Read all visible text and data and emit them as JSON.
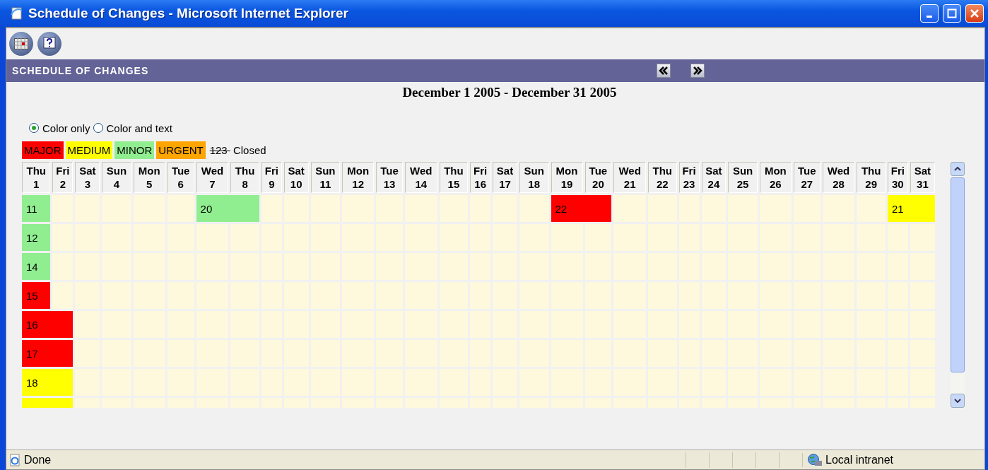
{
  "window": {
    "title": "Schedule of Changes - Microsoft Internet Explorer"
  },
  "header": {
    "title": "SCHEDULE OF CHANGES"
  },
  "date_range": "December 1 2005 - December 31 2005",
  "view_options": [
    {
      "label": "Color only",
      "selected": true
    },
    {
      "label": "Color and text",
      "selected": false
    }
  ],
  "legend": [
    {
      "kind": "swatch",
      "label": "MAJOR",
      "color": "#ff0000"
    },
    {
      "kind": "swatch",
      "label": "MEDIUM",
      "color": "#ffff00"
    },
    {
      "kind": "swatch",
      "label": "MINOR",
      "color": "#90ee90"
    },
    {
      "kind": "swatch",
      "label": "URGENT",
      "color": "#ffa500"
    },
    {
      "kind": "closed",
      "sample": "123",
      "label": "Closed"
    }
  ],
  "days": [
    {
      "weekday": "Thu",
      "day": "1"
    },
    {
      "weekday": "Fri",
      "day": "2"
    },
    {
      "weekday": "Sat",
      "day": "3"
    },
    {
      "weekday": "Sun",
      "day": "4"
    },
    {
      "weekday": "Mon",
      "day": "5"
    },
    {
      "weekday": "Tue",
      "day": "6"
    },
    {
      "weekday": "Wed",
      "day": "7"
    },
    {
      "weekday": "Thu",
      "day": "8"
    },
    {
      "weekday": "Fri",
      "day": "9"
    },
    {
      "weekday": "Sat",
      "day": "10"
    },
    {
      "weekday": "Sun",
      "day": "11"
    },
    {
      "weekday": "Mon",
      "day": "12"
    },
    {
      "weekday": "Tue",
      "day": "13"
    },
    {
      "weekday": "Wed",
      "day": "14"
    },
    {
      "weekday": "Thu",
      "day": "15"
    },
    {
      "weekday": "Fri",
      "day": "16"
    },
    {
      "weekday": "Sat",
      "day": "17"
    },
    {
      "weekday": "Sun",
      "day": "18"
    },
    {
      "weekday": "Mon",
      "day": "19"
    },
    {
      "weekday": "Tue",
      "day": "20"
    },
    {
      "weekday": "Wed",
      "day": "21"
    },
    {
      "weekday": "Thu",
      "day": "22"
    },
    {
      "weekday": "Fri",
      "day": "23"
    },
    {
      "weekday": "Sat",
      "day": "24"
    },
    {
      "weekday": "Sun",
      "day": "25"
    },
    {
      "weekday": "Mon",
      "day": "26"
    },
    {
      "weekday": "Tue",
      "day": "27"
    },
    {
      "weekday": "Wed",
      "day": "28"
    },
    {
      "weekday": "Thu",
      "day": "29"
    },
    {
      "weekday": "Fri",
      "day": "30"
    },
    {
      "weekday": "Sat",
      "day": "31"
    }
  ],
  "rows": [
    {
      "cells": [
        {
          "kind": "change",
          "label": "11",
          "color": "#90ee90"
        },
        {
          "kind": "empty"
        },
        {
          "kind": "empty"
        },
        {
          "kind": "empty"
        },
        {
          "kind": "empty"
        },
        {
          "kind": "empty"
        },
        {
          "kind": "change",
          "label": "20",
          "color": "#90ee90"
        },
        {
          "kind": "continued"
        },
        {
          "kind": "empty"
        },
        {
          "kind": "empty"
        },
        {
          "kind": "empty"
        },
        {
          "kind": "empty"
        },
        {
          "kind": "empty"
        },
        {
          "kind": "empty"
        },
        {
          "kind": "empty"
        },
        {
          "kind": "empty"
        },
        {
          "kind": "empty"
        },
        {
          "kind": "empty"
        },
        {
          "kind": "change",
          "label": "22",
          "color": "#ff0000"
        },
        {
          "kind": "continued"
        },
        {
          "kind": "empty"
        },
        {
          "kind": "empty"
        },
        {
          "kind": "empty"
        },
        {
          "kind": "empty"
        },
        {
          "kind": "empty"
        },
        {
          "kind": "empty"
        },
        {
          "kind": "empty"
        },
        {
          "kind": "empty"
        },
        {
          "kind": "empty"
        },
        {
          "kind": "change",
          "label": "21",
          "color": "#ffff00"
        },
        {
          "kind": "continued"
        }
      ]
    },
    {
      "cells": [
        {
          "kind": "change",
          "label": "12",
          "color": "#90ee90"
        },
        {
          "kind": "empty"
        },
        {
          "kind": "empty"
        },
        {
          "kind": "empty"
        },
        {
          "kind": "empty"
        },
        {
          "kind": "empty"
        },
        {
          "kind": "empty"
        },
        {
          "kind": "empty"
        },
        {
          "kind": "empty"
        },
        {
          "kind": "empty"
        },
        {
          "kind": "empty"
        },
        {
          "kind": "empty"
        },
        {
          "kind": "empty"
        },
        {
          "kind": "empty"
        },
        {
          "kind": "empty"
        },
        {
          "kind": "empty"
        },
        {
          "kind": "empty"
        },
        {
          "kind": "empty"
        },
        {
          "kind": "empty"
        },
        {
          "kind": "empty"
        },
        {
          "kind": "empty"
        },
        {
          "kind": "empty"
        },
        {
          "kind": "empty"
        },
        {
          "kind": "empty"
        },
        {
          "kind": "empty"
        },
        {
          "kind": "empty"
        },
        {
          "kind": "empty"
        },
        {
          "kind": "empty"
        },
        {
          "kind": "empty"
        },
        {
          "kind": "empty"
        },
        {
          "kind": "empty"
        }
      ]
    },
    {
      "cells": [
        {
          "kind": "change",
          "label": "14",
          "color": "#90ee90"
        },
        {
          "kind": "empty"
        },
        {
          "kind": "empty"
        },
        {
          "kind": "empty"
        },
        {
          "kind": "empty"
        },
        {
          "kind": "empty"
        },
        {
          "kind": "empty"
        },
        {
          "kind": "empty"
        },
        {
          "kind": "empty"
        },
        {
          "kind": "empty"
        },
        {
          "kind": "empty"
        },
        {
          "kind": "empty"
        },
        {
          "kind": "empty"
        },
        {
          "kind": "empty"
        },
        {
          "kind": "empty"
        },
        {
          "kind": "empty"
        },
        {
          "kind": "empty"
        },
        {
          "kind": "empty"
        },
        {
          "kind": "empty"
        },
        {
          "kind": "empty"
        },
        {
          "kind": "empty"
        },
        {
          "kind": "empty"
        },
        {
          "kind": "empty"
        },
        {
          "kind": "empty"
        },
        {
          "kind": "empty"
        },
        {
          "kind": "empty"
        },
        {
          "kind": "empty"
        },
        {
          "kind": "empty"
        },
        {
          "kind": "empty"
        },
        {
          "kind": "empty"
        },
        {
          "kind": "empty"
        }
      ]
    },
    {
      "cells": [
        {
          "kind": "change",
          "label": "15",
          "color": "#ff0000"
        },
        {
          "kind": "empty"
        },
        {
          "kind": "empty"
        },
        {
          "kind": "empty"
        },
        {
          "kind": "empty"
        },
        {
          "kind": "empty"
        },
        {
          "kind": "empty"
        },
        {
          "kind": "empty"
        },
        {
          "kind": "empty"
        },
        {
          "kind": "empty"
        },
        {
          "kind": "empty"
        },
        {
          "kind": "empty"
        },
        {
          "kind": "empty"
        },
        {
          "kind": "empty"
        },
        {
          "kind": "empty"
        },
        {
          "kind": "empty"
        },
        {
          "kind": "empty"
        },
        {
          "kind": "empty"
        },
        {
          "kind": "empty"
        },
        {
          "kind": "empty"
        },
        {
          "kind": "empty"
        },
        {
          "kind": "empty"
        },
        {
          "kind": "empty"
        },
        {
          "kind": "empty"
        },
        {
          "kind": "empty"
        },
        {
          "kind": "empty"
        },
        {
          "kind": "empty"
        },
        {
          "kind": "empty"
        },
        {
          "kind": "empty"
        },
        {
          "kind": "empty"
        },
        {
          "kind": "empty"
        }
      ]
    },
    {
      "cells": [
        {
          "kind": "change",
          "label": "16",
          "color": "#ff0000"
        },
        {
          "kind": "continued"
        },
        {
          "kind": "empty"
        },
        {
          "kind": "empty"
        },
        {
          "kind": "empty"
        },
        {
          "kind": "empty"
        },
        {
          "kind": "empty"
        },
        {
          "kind": "empty"
        },
        {
          "kind": "empty"
        },
        {
          "kind": "empty"
        },
        {
          "kind": "empty"
        },
        {
          "kind": "empty"
        },
        {
          "kind": "empty"
        },
        {
          "kind": "empty"
        },
        {
          "kind": "empty"
        },
        {
          "kind": "empty"
        },
        {
          "kind": "empty"
        },
        {
          "kind": "empty"
        },
        {
          "kind": "empty"
        },
        {
          "kind": "empty"
        },
        {
          "kind": "empty"
        },
        {
          "kind": "empty"
        },
        {
          "kind": "empty"
        },
        {
          "kind": "empty"
        },
        {
          "kind": "empty"
        },
        {
          "kind": "empty"
        },
        {
          "kind": "empty"
        },
        {
          "kind": "empty"
        },
        {
          "kind": "empty"
        },
        {
          "kind": "empty"
        },
        {
          "kind": "empty"
        }
      ]
    },
    {
      "cells": [
        {
          "kind": "change",
          "label": "17",
          "color": "#ff0000"
        },
        {
          "kind": "continued"
        },
        {
          "kind": "empty"
        },
        {
          "kind": "empty"
        },
        {
          "kind": "empty"
        },
        {
          "kind": "empty"
        },
        {
          "kind": "empty"
        },
        {
          "kind": "empty"
        },
        {
          "kind": "empty"
        },
        {
          "kind": "empty"
        },
        {
          "kind": "empty"
        },
        {
          "kind": "empty"
        },
        {
          "kind": "empty"
        },
        {
          "kind": "empty"
        },
        {
          "kind": "empty"
        },
        {
          "kind": "empty"
        },
        {
          "kind": "empty"
        },
        {
          "kind": "empty"
        },
        {
          "kind": "empty"
        },
        {
          "kind": "empty"
        },
        {
          "kind": "empty"
        },
        {
          "kind": "empty"
        },
        {
          "kind": "empty"
        },
        {
          "kind": "empty"
        },
        {
          "kind": "empty"
        },
        {
          "kind": "empty"
        },
        {
          "kind": "empty"
        },
        {
          "kind": "empty"
        },
        {
          "kind": "empty"
        },
        {
          "kind": "empty"
        },
        {
          "kind": "empty"
        }
      ]
    },
    {
      "cells": [
        {
          "kind": "change",
          "label": "18",
          "color": "#ffff00"
        },
        {
          "kind": "continued"
        },
        {
          "kind": "empty"
        },
        {
          "kind": "empty"
        },
        {
          "kind": "empty"
        },
        {
          "kind": "empty"
        },
        {
          "kind": "empty"
        },
        {
          "kind": "empty"
        },
        {
          "kind": "empty"
        },
        {
          "kind": "empty"
        },
        {
          "kind": "empty"
        },
        {
          "kind": "empty"
        },
        {
          "kind": "empty"
        },
        {
          "kind": "empty"
        },
        {
          "kind": "empty"
        },
        {
          "kind": "empty"
        },
        {
          "kind": "empty"
        },
        {
          "kind": "empty"
        },
        {
          "kind": "empty"
        },
        {
          "kind": "empty"
        },
        {
          "kind": "empty"
        },
        {
          "kind": "empty"
        },
        {
          "kind": "empty"
        },
        {
          "kind": "empty"
        },
        {
          "kind": "empty"
        },
        {
          "kind": "empty"
        },
        {
          "kind": "empty"
        },
        {
          "kind": "empty"
        },
        {
          "kind": "empty"
        },
        {
          "kind": "empty"
        },
        {
          "kind": "empty"
        }
      ]
    },
    {
      "cells": [
        {
          "kind": "change",
          "color": "#ffff00"
        },
        {
          "kind": "continued"
        },
        {
          "kind": "empty"
        },
        {
          "kind": "empty"
        },
        {
          "kind": "empty"
        },
        {
          "kind": "empty"
        },
        {
          "kind": "empty"
        },
        {
          "kind": "empty"
        },
        {
          "kind": "empty"
        },
        {
          "kind": "empty"
        },
        {
          "kind": "empty"
        },
        {
          "kind": "empty"
        },
        {
          "kind": "empty"
        },
        {
          "kind": "empty"
        },
        {
          "kind": "empty"
        },
        {
          "kind": "empty"
        },
        {
          "kind": "empty"
        },
        {
          "kind": "empty"
        },
        {
          "kind": "empty"
        },
        {
          "kind": "empty"
        },
        {
          "kind": "empty"
        },
        {
          "kind": "empty"
        },
        {
          "kind": "empty"
        },
        {
          "kind": "empty"
        },
        {
          "kind": "empty"
        },
        {
          "kind": "empty"
        },
        {
          "kind": "empty"
        },
        {
          "kind": "empty"
        },
        {
          "kind": "empty"
        },
        {
          "kind": "empty"
        },
        {
          "kind": "empty"
        }
      ]
    }
  ],
  "status_bar": {
    "status": "Done",
    "zone": "Local intranet"
  }
}
